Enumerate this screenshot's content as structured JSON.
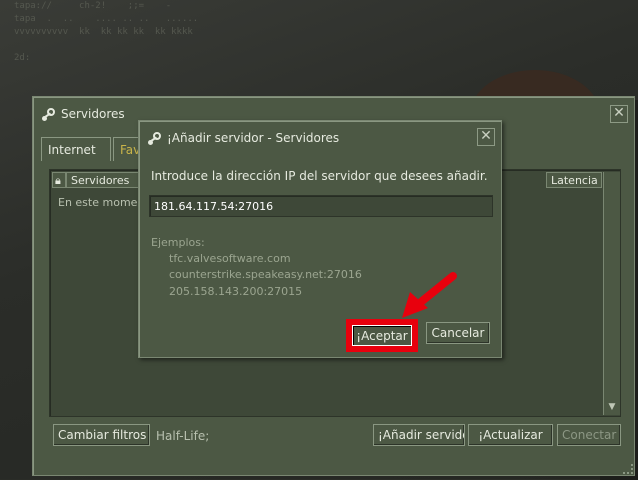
{
  "main_window": {
    "title": "Servidores",
    "tabs": [
      "Internet",
      "Fav"
    ],
    "columns": {
      "servers": "Servidores",
      "latency": "Latencia"
    },
    "empty_message": "En este mome",
    "buttons": {
      "change_filters": "Cambiar filtros",
      "add_server": "¡Añadir servido",
      "refresh": "¡Actualizar",
      "connect": "Conectar"
    },
    "filter_text": "Half-Life;"
  },
  "dialog": {
    "title": "¡Añadir servidor - Servidores",
    "prompt": "Introduce la dirección IP del servidor que desees añadir.",
    "ip_value": "181.64.117.54:27016",
    "examples_label": "Ejemplos:",
    "examples": [
      "tfc.valvesoftware.com",
      "counterstrike.speakeasy.net:27016",
      "205.158.143.200:27015"
    ],
    "accept_label": "¡Aceptar",
    "cancel_label": "Cancelar"
  },
  "icons": {
    "window": "steam-icon",
    "close": "close-icon",
    "lock": "lock-icon",
    "annotation": "red-arrow-icon"
  },
  "colors": {
    "highlight": "#e8000d",
    "panel": "#4c5844",
    "fav_tab": "#c9b44a"
  },
  "background_text": "tapa://     ch-2!    ;;=    -\ntapa  .  ..    .... .. ..   ......\nvvvvvvvvvv  kk  kk kk kk  kk kkkk\n\n2d:"
}
